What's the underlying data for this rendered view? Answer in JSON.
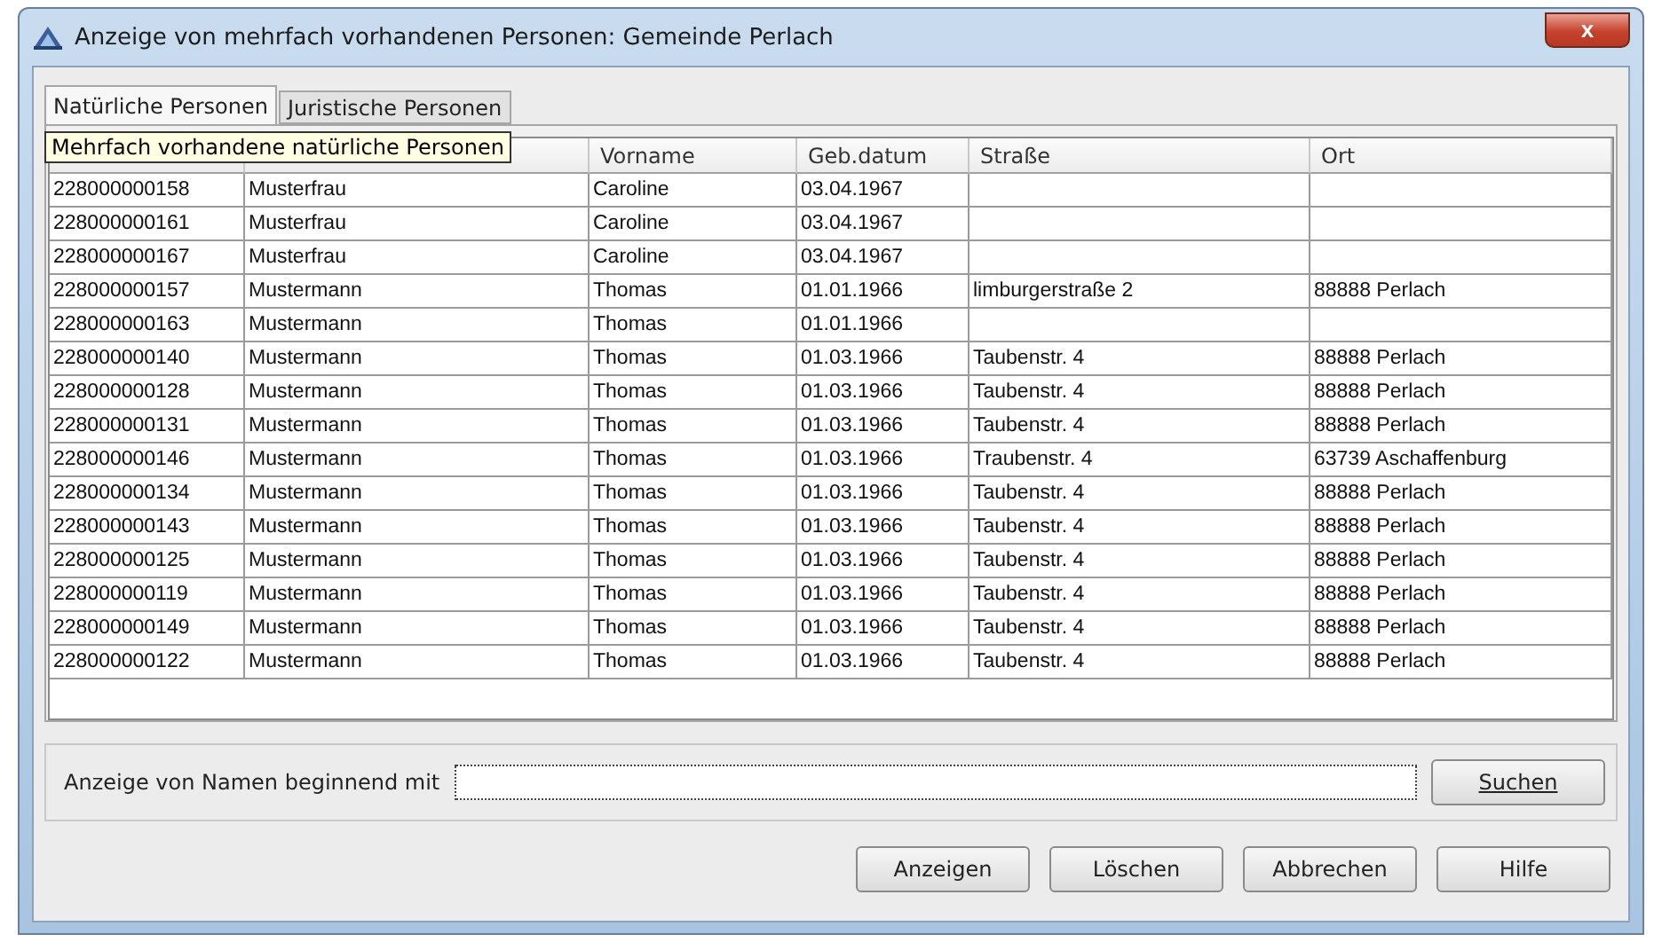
{
  "window": {
    "title": "Anzeige von mehrfach vorhandenen Personen: Gemeinde Perlach",
    "close": "x"
  },
  "tabs": [
    {
      "label": "Natürliche Personen",
      "selected": true
    },
    {
      "label": "Juristische Personen",
      "selected": false
    }
  ],
  "tooltip": "Mehrfach vorhandene natürliche Personen",
  "table": {
    "columns": [
      null,
      null,
      "Vorname",
      "Geb.datum",
      "Straße",
      "Ort"
    ],
    "rows": [
      [
        "228000000158",
        "Musterfrau",
        "Caroline",
        "03.04.1967",
        "",
        ""
      ],
      [
        "228000000161",
        "Musterfrau",
        "Caroline",
        "03.04.1967",
        "",
        ""
      ],
      [
        "228000000167",
        "Musterfrau",
        "Caroline",
        "03.04.1967",
        "",
        ""
      ],
      [
        "228000000157",
        "Mustermann",
        "Thomas",
        "01.01.1966",
        "limburgerstraße 2",
        "88888 Perlach"
      ],
      [
        "228000000163",
        "Mustermann",
        "Thomas",
        "01.01.1966",
        "",
        ""
      ],
      [
        "228000000140",
        "Mustermann",
        "Thomas",
        "01.03.1966",
        "Taubenstr. 4",
        "88888 Perlach"
      ],
      [
        "228000000128",
        "Mustermann",
        "Thomas",
        "01.03.1966",
        "Taubenstr. 4",
        "88888 Perlach"
      ],
      [
        "228000000131",
        "Mustermann",
        "Thomas",
        "01.03.1966",
        "Taubenstr. 4",
        "88888 Perlach"
      ],
      [
        "228000000146",
        "Mustermann",
        "Thomas",
        "01.03.1966",
        "Traubenstr. 4",
        "63739 Aschaffenburg"
      ],
      [
        "228000000134",
        "Mustermann",
        "Thomas",
        "01.03.1966",
        "Taubenstr. 4",
        "88888 Perlach"
      ],
      [
        "228000000143",
        "Mustermann",
        "Thomas",
        "01.03.1966",
        "Taubenstr. 4",
        "88888 Perlach"
      ],
      [
        "228000000125",
        "Mustermann",
        "Thomas",
        "01.03.1966",
        "Taubenstr. 4",
        "88888 Perlach"
      ],
      [
        "228000000119",
        "Mustermann",
        "Thomas",
        "01.03.1966",
        "Taubenstr. 4",
        "88888 Perlach"
      ],
      [
        "228000000149",
        "Mustermann",
        "Thomas",
        "01.03.1966",
        "Taubenstr. 4",
        "88888 Perlach"
      ],
      [
        "228000000122",
        "Mustermann",
        "Thomas",
        "01.03.1966",
        "Taubenstr. 4",
        "88888 Perlach"
      ]
    ]
  },
  "search": {
    "label": "Anzeige von Namen beginnend mit",
    "button": "**Suchen**"
  },
  "buttons": [
    "Anzeigen",
    "Löschen",
    "Abbrechen",
    "Hilfe"
  ]
}
